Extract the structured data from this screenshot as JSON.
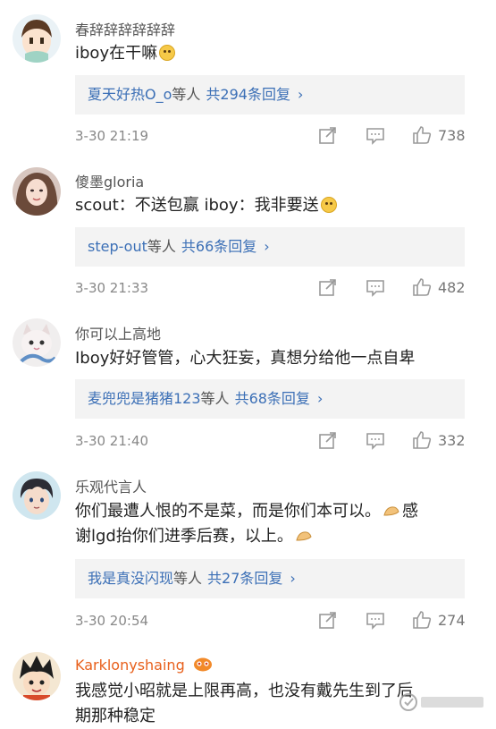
{
  "comments": [
    {
      "username": "春辞辞辞辞辞辞",
      "text": "iboy在干嘛",
      "reply_users": "夏天好热O_o",
      "reply_suffix": "等人",
      "reply_count": "共294条回复",
      "chevron": "›",
      "time": "3-30 21:19",
      "likes": "738",
      "avatar_icon": "cartoon-child-avatar"
    },
    {
      "username": "傻墨gloria",
      "text": "scout：不送包赢 iboy：我非要送",
      "reply_users": "step-out",
      "reply_suffix": "等人",
      "reply_count": "共66条回复",
      "chevron": "›",
      "time": "3-30 21:33",
      "likes": "482",
      "avatar_icon": "girl-photo-avatar"
    },
    {
      "username": "你可以上高地",
      "text": "Iboy好好管管，心大狂妄，真想分给他一点自卑",
      "reply_users": "麦兜兜是猪猪123",
      "reply_suffix": "等人",
      "reply_count": "共68条回复",
      "chevron": "›",
      "time": "3-30 21:40",
      "likes": "332",
      "avatar_icon": "cat-avatar"
    },
    {
      "username": "乐观代言人",
      "text_line1": "你们最遭人恨的不是菜，而是你们本可以。",
      "text_line1_tail": "感",
      "text_line2": "谢lgd抬你们进季后赛，以上。",
      "reply_users": "我是真没闪现",
      "reply_suffix": "等人",
      "reply_count": "共27条回复",
      "chevron": "›",
      "time": "3-30 20:54",
      "likes": "274",
      "avatar_icon": "anime-boy-avatar"
    },
    {
      "username": "Karklonyshaing",
      "text_line1": "我感觉小昭就是上限再高，也没有戴先生到了后",
      "text_line2": "期那种稳定",
      "avatar_icon": "anime-character-avatar",
      "badge_icon": "vip-crown-icon"
    }
  ],
  "icons": {
    "share": "share-icon",
    "comment": "comment-icon",
    "like": "thumbs-up-icon"
  },
  "colors": {
    "link": "#3b6fb6",
    "vip_name": "#e8601c",
    "reply_bg": "#f3f3f3",
    "meta_gray": "#888888"
  },
  "watermark": {
    "icon": "headline-q-and-a-watermark"
  }
}
